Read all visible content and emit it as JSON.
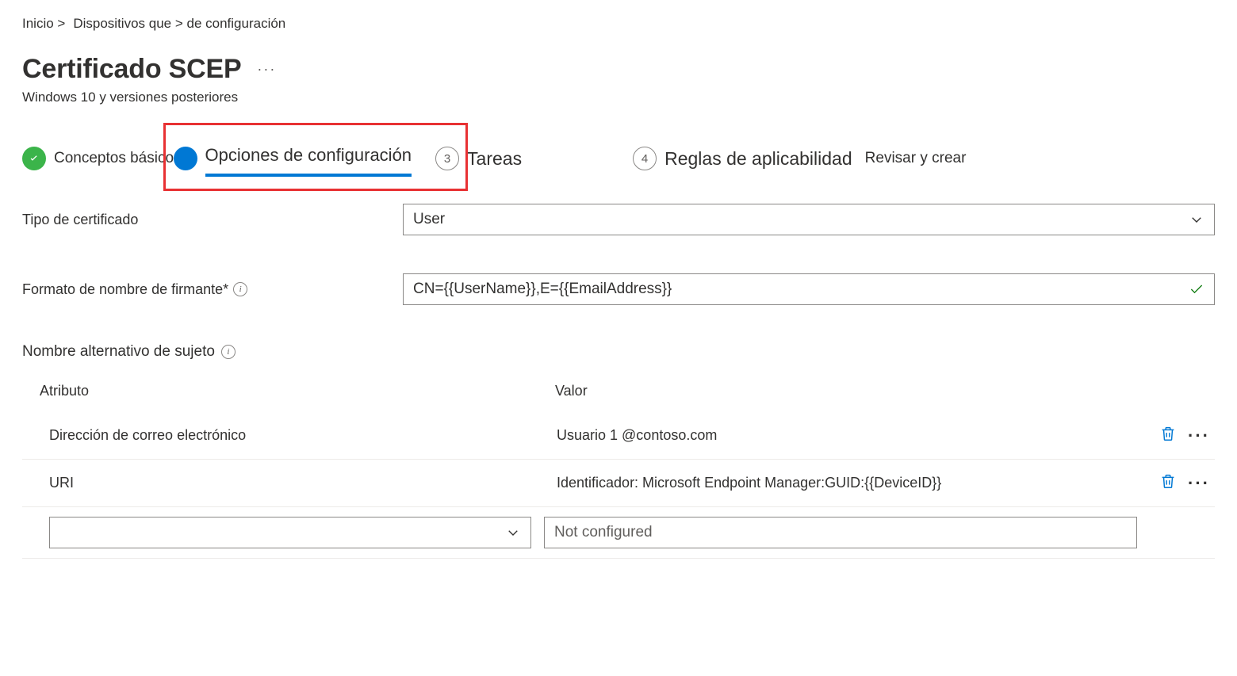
{
  "breadcrumb": {
    "item1": "Inicio >",
    "item2": "Dispositivos que > de configuración"
  },
  "header": {
    "title": "Certificado SCEP",
    "subtitle": "Windows 10 y versiones posteriores"
  },
  "steps": {
    "s1": {
      "label": "Conceptos básicos"
    },
    "s2": {
      "label": "Opciones de configuración"
    },
    "s3": {
      "num": "3",
      "label": "Tareas"
    },
    "s4": {
      "num": "4",
      "label": "Reglas de aplicabilidad"
    },
    "s5": {
      "label": "Revisar y crear"
    }
  },
  "form": {
    "cert_type_label": "Tipo de certificado",
    "cert_type_value": "User",
    "subject_format_label": "Formato de nombre de firmante*",
    "subject_format_value": "CN={{UserName}},E={{EmailAddress}}"
  },
  "san": {
    "title": "Nombre alternativo de sujeto",
    "col_attr": "Atributo",
    "col_val": "Valor",
    "rows": [
      {
        "attr": "Dirección de correo electrónico",
        "val": "Usuario 1 @contoso.com"
      },
      {
        "attr": "URI",
        "val": "Identificador: Microsoft Endpoint Manager:GUID:{{DeviceID}}"
      }
    ],
    "new_placeholder": "Not configured"
  }
}
